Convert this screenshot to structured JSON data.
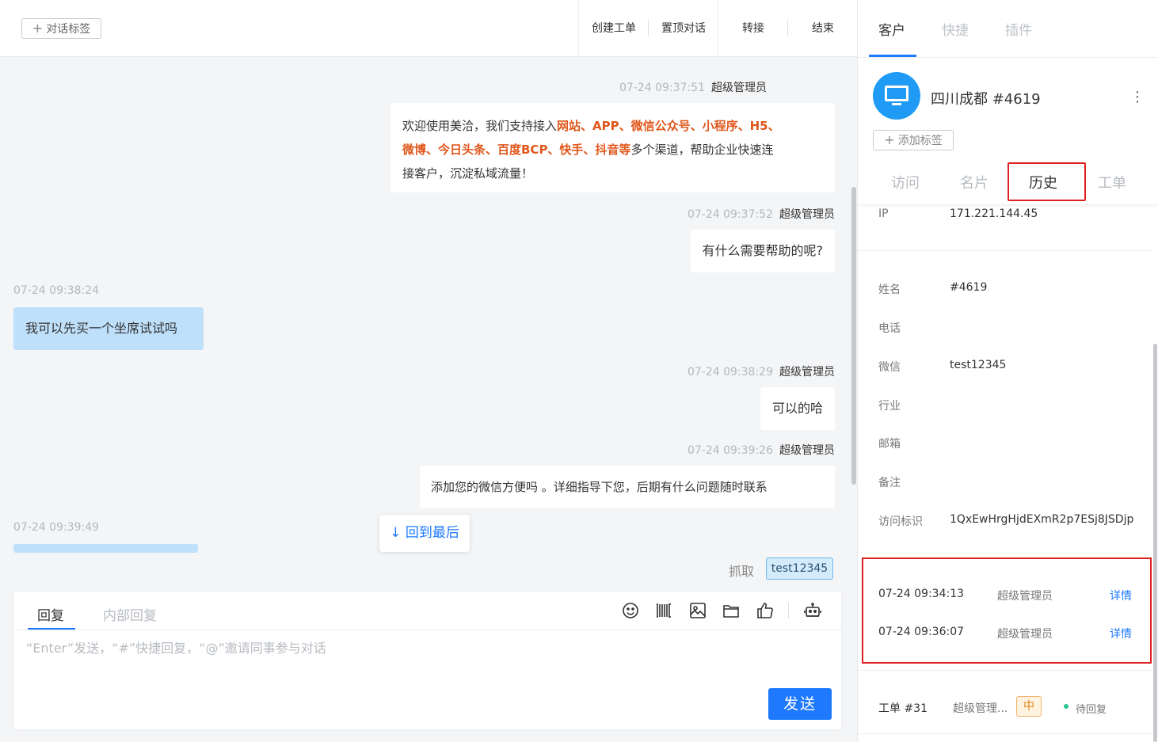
{
  "chat_header": {
    "tag_button": "对话标签",
    "actions": [
      "创建工单",
      "置顶对话",
      "转接",
      "结束"
    ]
  },
  "messages": [
    {
      "time": "07-24 09:37:51",
      "sender": "超级管理员",
      "side": "agent",
      "parts": [
        {
          "t": "欢迎使用美洽，我们支持接入",
          "hl": false
        },
        {
          "t": "网站、APP、微信公众号、小程序、H5、",
          "hl": true
        },
        {
          "t": "微博、今日头条、百度BCP、快手、抖音等",
          "hl": true
        },
        {
          "t": "多个渠道，帮助企业快速连",
          "hl": false
        },
        {
          "t": "接客户，沉淀私域流量！",
          "hl": false
        }
      ]
    },
    {
      "time": "07-24 09:37:52",
      "sender": "超级管理员",
      "side": "agent",
      "text": "有什么需要帮助的呢?"
    },
    {
      "time": "07-24 09:38:24",
      "side": "customer",
      "text": "我可以先买一个坐席试试吗"
    },
    {
      "time": "07-24 09:38:29",
      "sender": "超级管理员",
      "side": "agent",
      "text": "可以的哈"
    },
    {
      "time": "07-24 09:39:26",
      "sender": "超级管理员",
      "side": "agent",
      "text": "添加您的微信方便吗 。详细指导下您，后期有什么问题随时联系"
    },
    {
      "time": "07-24 09:39:49",
      "side": "customer",
      "text": ""
    }
  ],
  "back_to_last": "回到最后",
  "grab": {
    "label": "抓取",
    "tag": "test12345"
  },
  "reply": {
    "tabs": [
      "回复",
      "内部回复"
    ],
    "placeholder": "“Enter”发送，“#”快捷回复，“@”邀请同事参与对话",
    "send": "发送",
    "tools": [
      "emoji-icon",
      "barcode-icon",
      "image-icon",
      "folder-icon",
      "thumbs-up-icon",
      "robot-icon"
    ]
  },
  "side": {
    "tabs": [
      "客户",
      "快捷",
      "插件"
    ],
    "customer_name": "四川成都 #4619",
    "add_tag": "添加标签",
    "subtabs": [
      "访问",
      "名片",
      "历史",
      "工单"
    ],
    "ip_label": "IP",
    "ip_value": "171.221.144.45",
    "fields": [
      {
        "label": "姓名",
        "value": "#4619"
      },
      {
        "label": "电话",
        "value": ""
      },
      {
        "label": "微信",
        "value": "test12345"
      },
      {
        "label": "行业",
        "value": ""
      },
      {
        "label": "邮箱",
        "value": ""
      },
      {
        "label": "备注",
        "value": ""
      },
      {
        "label": "访问标识",
        "value": "1QxEwHrgHjdEXmR2p7ESj8JSDjp"
      }
    ],
    "history": [
      {
        "time": "07-24 09:34:13",
        "user": "超级管理员",
        "link": "详情"
      },
      {
        "time": "07-24 09:36:07",
        "user": "超级管理员",
        "link": "详情"
      }
    ],
    "ticket": {
      "id": "工单 #31",
      "user": "超级管理...",
      "priority": "中",
      "status": "待回复"
    }
  },
  "colors": {
    "accent": "#1f79ff",
    "highlight": "#e0571b",
    "customer_bubble": "#bfe0fb",
    "alert_red": "#e02020"
  }
}
